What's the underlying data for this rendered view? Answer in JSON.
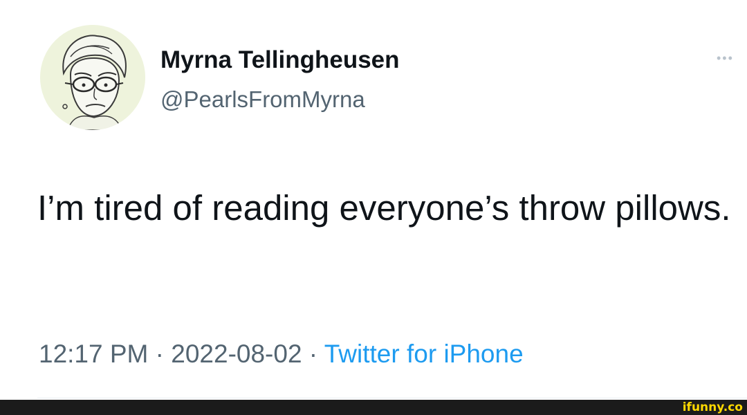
{
  "author": {
    "display_name": "Myrna Tellingheusen",
    "handle": "@PearlsFromMyrna",
    "avatar": "cartoon-elderly-woman-portrait"
  },
  "tweet": {
    "text": "I’m tired of reading everyone’s throw pillows."
  },
  "meta": {
    "time": "12:17 PM",
    "separator": " · ",
    "date": "2022-08-02",
    "source": "Twitter for iPhone"
  },
  "more_icon": "•••",
  "watermark": {
    "text": "ifunny.co",
    "color": "#ffd900"
  },
  "colors": {
    "name": "#0f1419",
    "secondary": "#536471",
    "link": "#1d9bf0"
  }
}
